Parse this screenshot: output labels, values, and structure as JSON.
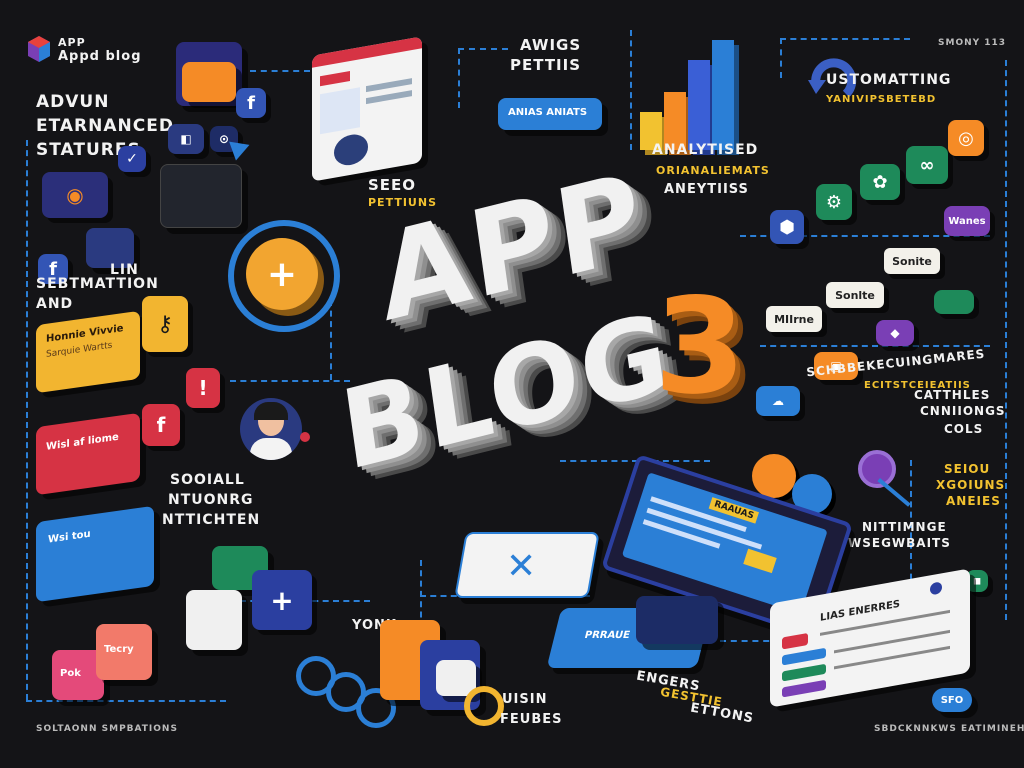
{
  "brand": {
    "line1": "APP",
    "line2": "Appd blog"
  },
  "top_right_tag": "SMONY 113",
  "hero": {
    "word1": "APP",
    "word2": "BLOG",
    "digit": "3"
  },
  "labels": {
    "adv1": "ADVUN",
    "adv2": "ETARNANCED",
    "adv3": "STATURES",
    "and1": "AND",
    "and2": "SEBTMATTION",
    "lin": "LIN",
    "awigs1": "AWIGS",
    "awigs2": "PETTIIS",
    "awigs_tab": "ANIAS ANIATS",
    "seeo1": "SEEO",
    "seeo2": "PETTIUNS",
    "analy1": "ANALYTISED",
    "analy2": "ORIANALIEMATS",
    "analy3": "ANEYTIISS",
    "ustom1": "USTOMATTING",
    "ustom2": "YANIVIPSBETEBD",
    "social1": "SOOIALL",
    "social2": "NTUONRG",
    "social3": "NTTICHTEN",
    "schbe1": "SCHBBEKECUINGMARES",
    "schbe2": "ECITSTCEIEATIIS",
    "capth1": "CATTHLES",
    "capth2": "CNNIIONGS",
    "capth3": "COLS",
    "seiou1": "SEIOU",
    "seiou2": "XGOIUNS",
    "seiou3": "ANEIES",
    "nitt1": "NITTIMNGE",
    "nitt2": "WSEGWBAITS",
    "usin1": "UISIN",
    "usin2": "FEUBES",
    "engers1": "ENGERS",
    "engers2": "GESTTIE",
    "engers3": "ETTONS",
    "yonk": "YONK",
    "bottom_left": "SOLTAONN SMPBATIONS",
    "bottom_right": "SBDCKNNKWS EATIMINEH",
    "sfo": "SFO"
  },
  "cards": {
    "yellow_title": "Honnie Vivvie",
    "yellow_sub": "Sarquie Wartts",
    "red_title": "Wisl af liome",
    "blue_title": "Wsi tou",
    "pink_left": "Pok",
    "pink_right": "Tecry",
    "phone_header": "RAAUAS",
    "wallet_label": "PRRAUE",
    "panel_title": "LIAS ENERRES"
  },
  "chips": [
    "MIIrne",
    "Sonlte",
    "Sonite",
    "Wanes"
  ],
  "colors": {
    "bg": "#141417",
    "accent_blue": "#2b7fd6",
    "yellow": "#f2c230",
    "orange": "#f58b26",
    "red": "#d63344",
    "purple": "#7a3fb5",
    "green": "#1e8a5a"
  },
  "icons": [
    "facebook-icon",
    "play-icon",
    "chart-icon",
    "user-icon",
    "plus-icon",
    "refresh-icon",
    "link-icon",
    "gear-icon",
    "phone-icon",
    "wallet-icon",
    "key-icon"
  ]
}
